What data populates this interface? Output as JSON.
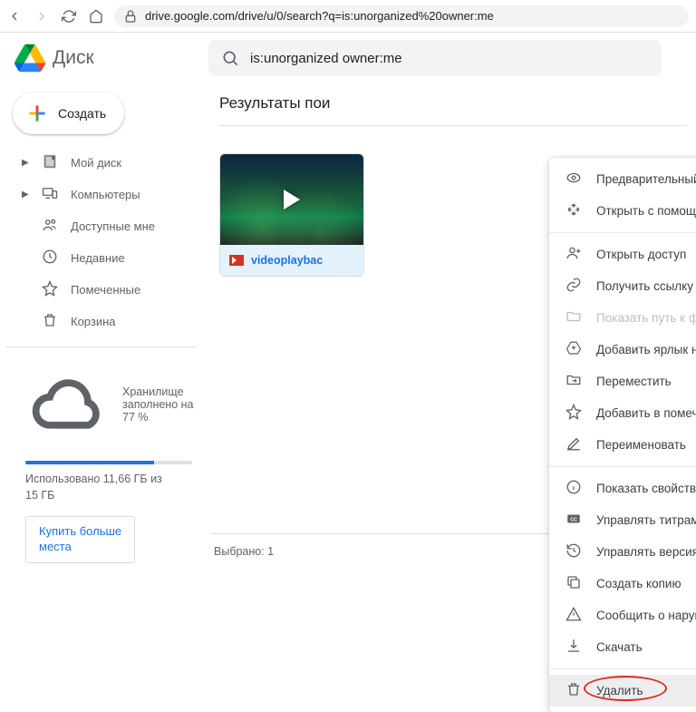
{
  "browser": {
    "url": "drive.google.com/drive/u/0/search?q=is:unorganized%20owner:me"
  },
  "header": {
    "app_name": "Диск",
    "search_value": "is:unorganized owner:me"
  },
  "create_button": {
    "label": "Создать"
  },
  "sidebar": {
    "items": [
      {
        "label": "Мой диск",
        "icon": "drive-icon",
        "expandable": true
      },
      {
        "label": "Компьютеры",
        "icon": "devices-icon",
        "expandable": true
      },
      {
        "label": "Доступные мне",
        "icon": "shared-icon",
        "expandable": false
      },
      {
        "label": "Недавние",
        "icon": "clock-icon",
        "expandable": false
      },
      {
        "label": "Помеченные",
        "icon": "star-icon",
        "expandable": false
      },
      {
        "label": "Корзина",
        "icon": "trash-icon",
        "expandable": false
      }
    ],
    "storage_label": "Хранилище заполнено на 77 %",
    "storage_percent": 77,
    "storage_line1": "Использовано 11,66 ГБ из",
    "storage_line2": "15 ГБ",
    "buy_line1": "Купить больше",
    "buy_line2": "места"
  },
  "main": {
    "results_title": "Результаты пои",
    "file_name": "videoplaybac",
    "footer_text": "Выбрано: 1"
  },
  "context_menu": {
    "groups": [
      [
        {
          "label": "Предварительный просмотр",
          "icon": "eye-icon"
        },
        {
          "label": "Открыть с помощью",
          "icon": "open-with-icon",
          "submenu": true
        }
      ],
      [
        {
          "label": "Открыть доступ",
          "icon": "person-add-icon"
        },
        {
          "label": "Получить ссылку",
          "icon": "link-icon"
        },
        {
          "label": "Показать путь к файлу",
          "icon": "folder-icon",
          "disabled": true
        },
        {
          "label": "Добавить ярлык на Диск",
          "icon": "drive-add-icon",
          "info": true
        },
        {
          "label": "Переместить",
          "icon": "move-icon"
        },
        {
          "label": "Добавить в помеченные",
          "icon": "star-icon"
        },
        {
          "label": "Переименовать",
          "icon": "rename-icon"
        }
      ],
      [
        {
          "label": "Показать свойства",
          "icon": "info-icon"
        },
        {
          "label": "Управлять титрами",
          "icon": "cc-icon"
        },
        {
          "label": "Управлять версиями",
          "icon": "versions-icon"
        },
        {
          "label": "Создать копию",
          "icon": "copy-icon"
        },
        {
          "label": "Сообщить о нарушении",
          "icon": "report-icon"
        },
        {
          "label": "Скачать",
          "icon": "download-icon"
        }
      ],
      [
        {
          "label": "Удалить",
          "icon": "trash-icon",
          "highlight": true
        }
      ]
    ]
  }
}
